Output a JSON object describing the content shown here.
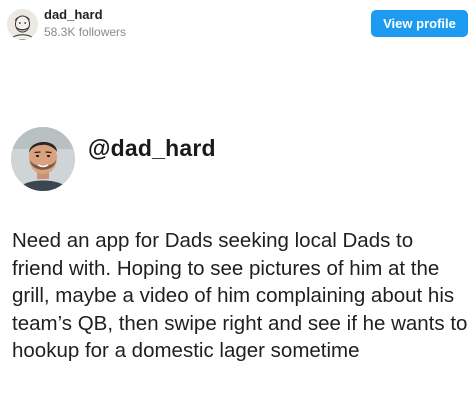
{
  "header": {
    "account_name": "dad_hard",
    "followers": "58.3K followers",
    "view_profile_label": "View profile",
    "accent_color": "#1d9bf0"
  },
  "tweet": {
    "handle": "@dad_hard",
    "text": "Need an app for Dads seeking local Dads to friend with. Hoping to see pictures of him at the grill, maybe a video of him complaining about his team’s QB, then swipe right and see if he wants to hookup for a domestic lager sometime"
  },
  "icons": {
    "small_avatar": "avatar-sketch-icon",
    "large_avatar": "profile-photo"
  }
}
